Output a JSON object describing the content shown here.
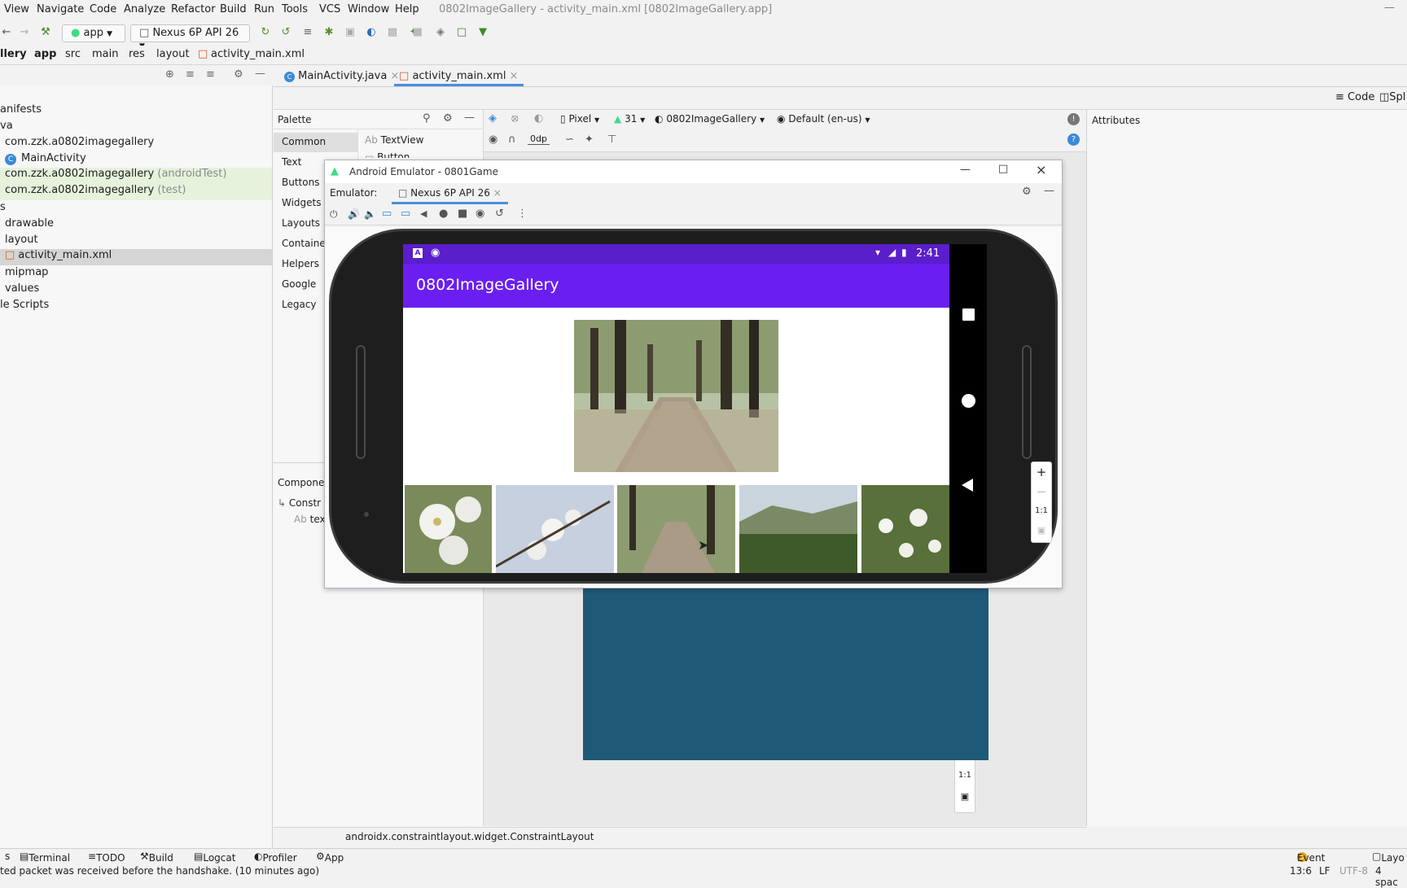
{
  "menu": [
    "View",
    "Navigate",
    "Code",
    "Analyze",
    "Refactor",
    "Build",
    "Run",
    "Tools",
    "VCS",
    "Window",
    "Help"
  ],
  "window_title": "0802ImageGallery - activity_main.xml [0802ImageGallery.app]",
  "toolbar": {
    "config_combo": "app",
    "device_combo": "Nexus 6P API 26"
  },
  "breadcrumbs": [
    "llery",
    "app",
    "src",
    "main",
    "res",
    "layout",
    "activity_main.xml"
  ],
  "editor_tabs": [
    {
      "label": "MainActivity.java"
    },
    {
      "label": "activity_main.xml"
    }
  ],
  "view_modes": {
    "code": "Code",
    "split": "Spl"
  },
  "project_tree": [
    {
      "label": "anifests"
    },
    {
      "label": "va"
    },
    {
      "label": "com.zzk.a0802imagegallery"
    },
    {
      "label": "MainActivity"
    },
    {
      "label": "com.zzk.a0802imagegallery",
      "suffix": "(androidTest)"
    },
    {
      "label": "com.zzk.a0802imagegallery",
      "suffix": "(test)"
    },
    {
      "label": "s"
    },
    {
      "label": "drawable"
    },
    {
      "label": "layout"
    },
    {
      "label": "activity_main.xml"
    },
    {
      "label": "mipmap"
    },
    {
      "label": "values"
    },
    {
      "label": "le Scripts"
    }
  ],
  "palette": {
    "title": "Palette",
    "categories": [
      "Common",
      "Text",
      "Buttons",
      "Widgets",
      "Layouts",
      "Container",
      "Helpers",
      "Google",
      "Legacy"
    ],
    "items": [
      "TextView",
      "Button"
    ]
  },
  "design_toolbar": {
    "margin": "0dp",
    "device": "Pixel",
    "api": "31",
    "theme": "0802ImageGallery",
    "locale": "Default (en-us)"
  },
  "attributes_title": "Attributes",
  "component_tree": {
    "title": "Componen",
    "root": "Constr",
    "child": "tex"
  },
  "emulator": {
    "window_title": "Android Emulator - 0801Game",
    "label": "Emulator:",
    "device_tab": "Nexus 6P API 26",
    "clock": "2:41",
    "app_title": "0802ImageGallery",
    "zoom_ratio": "1:1"
  },
  "design_zoom_ratio": "1:1",
  "layout_class": "androidx.constraintlayout.widget.ConstraintLayout",
  "bottom_tools": [
    "Terminal",
    "TODO",
    "Build",
    "Logcat",
    "Profiler",
    "App Inspection"
  ],
  "event_log": "Event Log",
  "layout_inspector": "Layo",
  "status_message": "ted packet was received before the handshake. (10 minutes ago)",
  "cursor_pos": "13:6",
  "line_sep": "LF",
  "encoding": "UTF-8",
  "indent": "4 spac"
}
